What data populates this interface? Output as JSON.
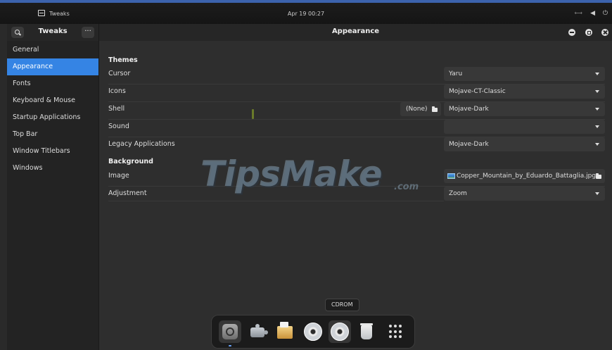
{
  "topbar": {
    "app_name": "Tweaks",
    "clock": "Apr 19 00:27"
  },
  "sidebar": {
    "title": "Tweaks",
    "menu_glyph": "···",
    "items": [
      {
        "label": "General"
      },
      {
        "label": "Appearance"
      },
      {
        "label": "Fonts"
      },
      {
        "label": "Keyboard & Mouse"
      },
      {
        "label": "Startup Applications"
      },
      {
        "label": "Top Bar"
      },
      {
        "label": "Window Titlebars"
      },
      {
        "label": "Windows"
      }
    ],
    "active_index": 1
  },
  "main": {
    "title": "Appearance",
    "themes": {
      "heading": "Themes",
      "rows": [
        {
          "label": "Cursor",
          "value": "Yaru"
        },
        {
          "label": "Icons",
          "value": "Mojave-CT-Classic"
        },
        {
          "label": "Shell",
          "value": "Mojave-Dark",
          "file_button": "(None)"
        },
        {
          "label": "Sound",
          "value": ""
        },
        {
          "label": "Legacy Applications",
          "value": "Mojave-Dark"
        }
      ]
    },
    "background": {
      "heading": "Background",
      "rows": [
        {
          "label": "Image",
          "value": "Copper_Mountain_by_Eduardo_Battaglia.jpg"
        },
        {
          "label": "Adjustment",
          "value": "Zoom"
        }
      ]
    }
  },
  "watermark": {
    "text": "TipsMake",
    "suffix": ".com"
  },
  "dock": {
    "tooltip": "CDROM",
    "items": [
      "settings-icon",
      "extensions-icon",
      "files-icon",
      "cdrom-icon",
      "cdrom-icon",
      "trash-icon",
      "app-grid-icon"
    ]
  },
  "colors": {
    "accent": "#3584e4",
    "topbar_accent": "#3c63ad",
    "sidebar_bg": "#232323",
    "content_bg": "#2e2e2e"
  }
}
